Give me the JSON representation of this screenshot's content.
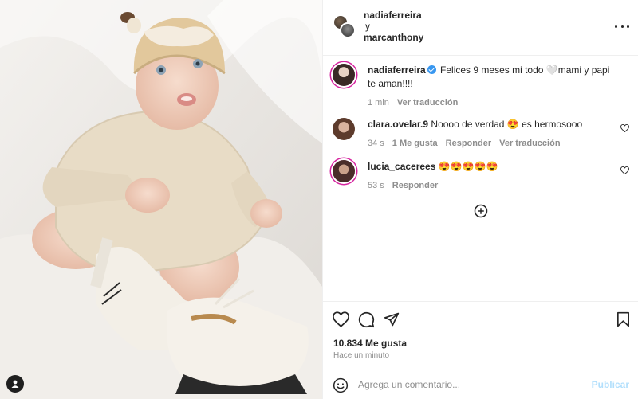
{
  "header": {
    "user1": "nadiaferreira",
    "conjunction": "y",
    "user2": "marcanthony",
    "more_icon": "more-horizontal-icon"
  },
  "caption": {
    "username": "nadiaferreira",
    "verified": true,
    "text": "Felices 9 meses mi todo 🤍mami y papi te aman!!!!",
    "time": "1 min",
    "translate": "Ver traducción"
  },
  "comments": [
    {
      "username": "clara.ovelar.9",
      "text": "Noooo de verdad 😍 es hermosooo",
      "time": "34 s",
      "likes": "1 Me gusta",
      "reply": "Responder",
      "translate": "Ver traducción"
    },
    {
      "username": "lucia_cacerees",
      "text": "😍😍😍😍😍",
      "time": "53 s",
      "reply": "Responder"
    }
  ],
  "actions": {
    "like_icon": "heart-icon",
    "comment_icon": "comment-icon",
    "share_icon": "send-icon",
    "save_icon": "bookmark-icon",
    "likes_count": "10.834 Me gusta",
    "posted": "Hace un minuto"
  },
  "add_comment": {
    "emoji_icon": "emoji-icon",
    "placeholder": "Agrega un comentario...",
    "post_label": "Publicar"
  },
  "colors": {
    "text": "#262626",
    "secondary": "#8e8e8e",
    "verified": "#3897f0",
    "post_disabled": "#b2dffc",
    "story_ring": "#d6249f"
  }
}
